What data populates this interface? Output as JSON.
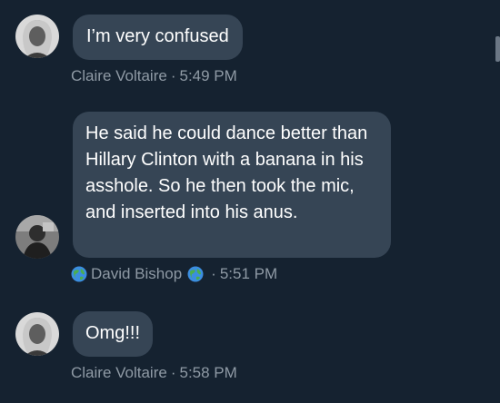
{
  "messages": [
    {
      "text": "I’m very confused",
      "author": "Claire Voltaire",
      "separator": "·",
      "time": "5:49 PM"
    },
    {
      "text": "He said he could dance better than Hillary Clinton with a banana in his asshole. So he then took the mic, and inserted into his anus.",
      "author": "David Bishop",
      "separator": "·",
      "time": "5:51 PM",
      "author_icons": [
        "globe-icon",
        "globe-icon"
      ]
    },
    {
      "text": "Omg!!!",
      "author": "Claire Voltaire",
      "separator": "·",
      "time": "5:58 PM"
    }
  ],
  "colors": {
    "background": "#152230",
    "bubble": "#364555",
    "meta_text": "#8f9aa5",
    "message_text": "#ffffff"
  }
}
